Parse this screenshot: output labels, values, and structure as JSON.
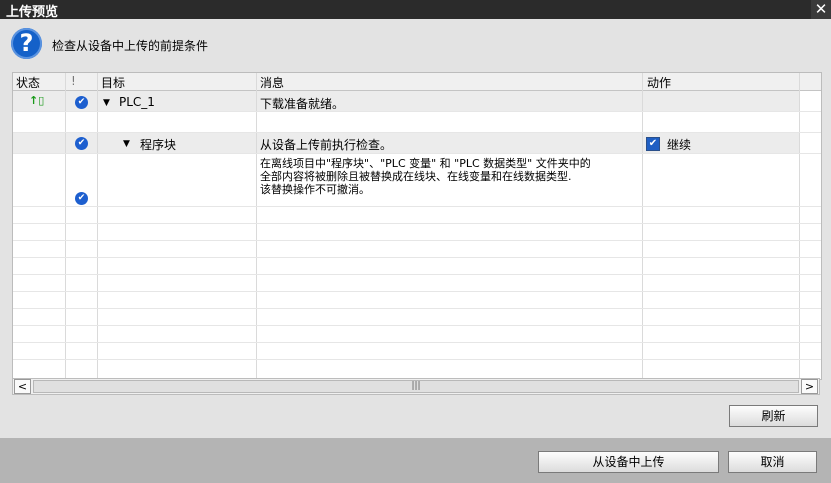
{
  "titlebar": {
    "title": "上传预览",
    "close": "✕"
  },
  "prompt": {
    "icon": "question-icon",
    "icon_glyph": "?",
    "text": "检查从设备中上传的前提条件"
  },
  "table": {
    "headers": {
      "status": "状态",
      "excl": "!",
      "target": "目标",
      "message": "消息",
      "action": "动作"
    },
    "rows": [
      {
        "status_icon": "upload-status-icon",
        "status_glyph": "↑▯",
        "check": true,
        "target": "PLC_1",
        "message": "下载准备就绪。",
        "action": ""
      },
      {
        "check": true,
        "target": "程序块",
        "message": "从设备上传前执行检查。",
        "action": "继续",
        "action_checked": true
      },
      {
        "check": true,
        "message_lines": [
          "在离线项目中\"程序块\"、\"PLC 变量\" 和 \"PLC 数据类型\" 文件夹中的",
          "全部内容将被删除且被替换成在线块、在线变量和在线数据类型.",
          "该替换操作不可撤消。"
        ]
      }
    ]
  },
  "scroll": {
    "left": "<",
    "right": ">",
    "grip": "|||"
  },
  "buttons": {
    "refresh": "刷新",
    "upload": "从设备中上传",
    "cancel": "取消"
  },
  "colors": {
    "accent": "#1d5fcf",
    "titlebar": "#2b2b2b"
  }
}
